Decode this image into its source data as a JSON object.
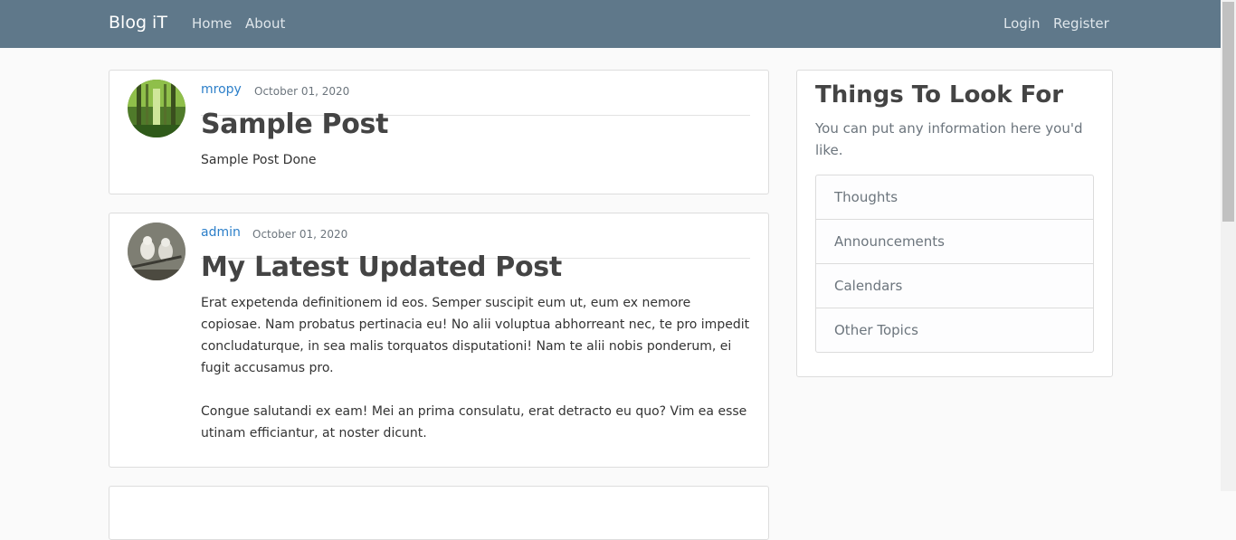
{
  "navbar": {
    "brand": "Blog iT",
    "links": [
      "Home",
      "About"
    ],
    "right_links": [
      "Login",
      "Register"
    ]
  },
  "posts": [
    {
      "author": "mropy",
      "date": "October 01, 2020",
      "title": "Sample Post",
      "paragraphs": [
        "Sample Post Done"
      ]
    },
    {
      "author": "admin",
      "date": "October 01, 2020",
      "title": "My Latest Updated Post",
      "paragraphs": [
        "Erat expetenda definitionem id eos. Semper suscipit eum ut, eum ex nemore copiosae. Nam probatus pertinacia eu! No alii voluptua abhorreant nec, te pro impedit concludaturque, in sea malis torquatos disputationi! Nam te alii nobis ponderum, ei fugit accusamus pro.",
        "Congue salutandi ex eam! Mei an prima consulatu, erat detracto eu quo? Vim ea esse utinam efficiantur, at noster dicunt."
      ]
    }
  ],
  "sidebar": {
    "title": "Things To Look For",
    "text": "You can put any information here you'd like.",
    "items": [
      "Thoughts",
      "Announcements",
      "Calendars",
      "Other Topics"
    ]
  },
  "colors": {
    "navbar": "#5f788a",
    "link": "#2c7fc9"
  }
}
